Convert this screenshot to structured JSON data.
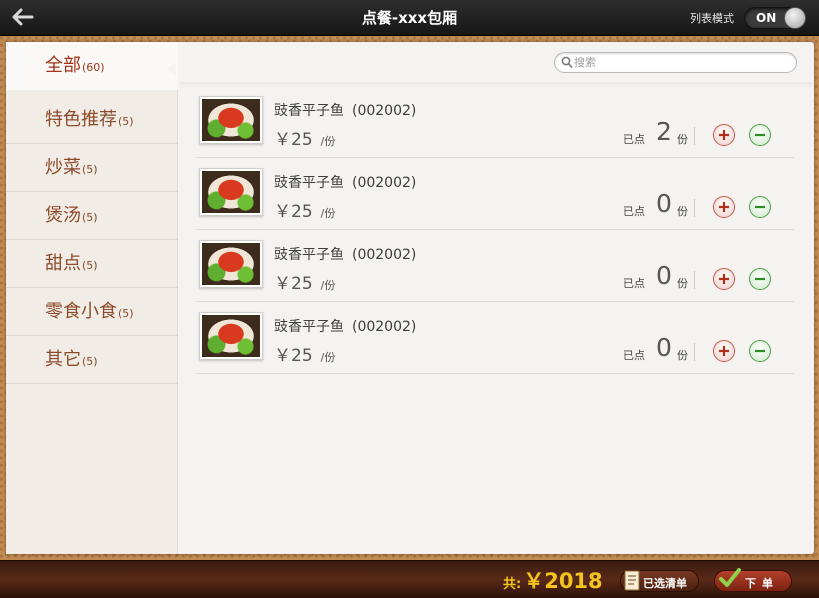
{
  "header": {
    "title": "点餐-xxx包厢",
    "mode_label": "列表模式",
    "toggle_state": "ON"
  },
  "categories": [
    {
      "name": "全部",
      "count": "(60)",
      "active": true
    },
    {
      "name": "特色推荐",
      "count": "(5)",
      "active": false
    },
    {
      "name": "炒菜",
      "count": "(5)",
      "active": false
    },
    {
      "name": "煲汤",
      "count": "(5)",
      "active": false
    },
    {
      "name": "甜点",
      "count": "(5)",
      "active": false
    },
    {
      "name": "零食小食",
      "count": "(5)",
      "active": false
    },
    {
      "name": "其它",
      "count": "(5)",
      "active": false
    }
  ],
  "search": {
    "placeholder": "搜索"
  },
  "dishes": [
    {
      "name": "豉香平子鱼",
      "code": "(002002)",
      "price": "￥25",
      "unit": "/份",
      "ordered_label": "已点",
      "qty": "2",
      "qty_unit": "份"
    },
    {
      "name": "豉香平子鱼",
      "code": "(002002)",
      "price": "￥25",
      "unit": "/份",
      "ordered_label": "已点",
      "qty": "0",
      "qty_unit": "份"
    },
    {
      "name": "豉香平子鱼",
      "code": "(002002)",
      "price": "￥25",
      "unit": "/份",
      "ordered_label": "已点",
      "qty": "0",
      "qty_unit": "份"
    },
    {
      "name": "豉香平子鱼",
      "code": "(002002)",
      "price": "￥25",
      "unit": "/份",
      "ordered_label": "已点",
      "qty": "0",
      "qty_unit": "份"
    }
  ],
  "footer": {
    "total_label": "共:",
    "total_value": "￥2018",
    "selected_list_label": "已选清单",
    "order_label": "下单"
  },
  "colors": {
    "accent": "#a13418",
    "category_text": "#8b4a2a",
    "total": "#f3c31f",
    "plus": "#c45a4a",
    "minus": "#4f9c4a"
  },
  "icons": [
    "back-arrow-icon",
    "toggle-knob-icon",
    "search-icon",
    "plus-icon",
    "minus-icon",
    "list-icon",
    "check-icon"
  ]
}
